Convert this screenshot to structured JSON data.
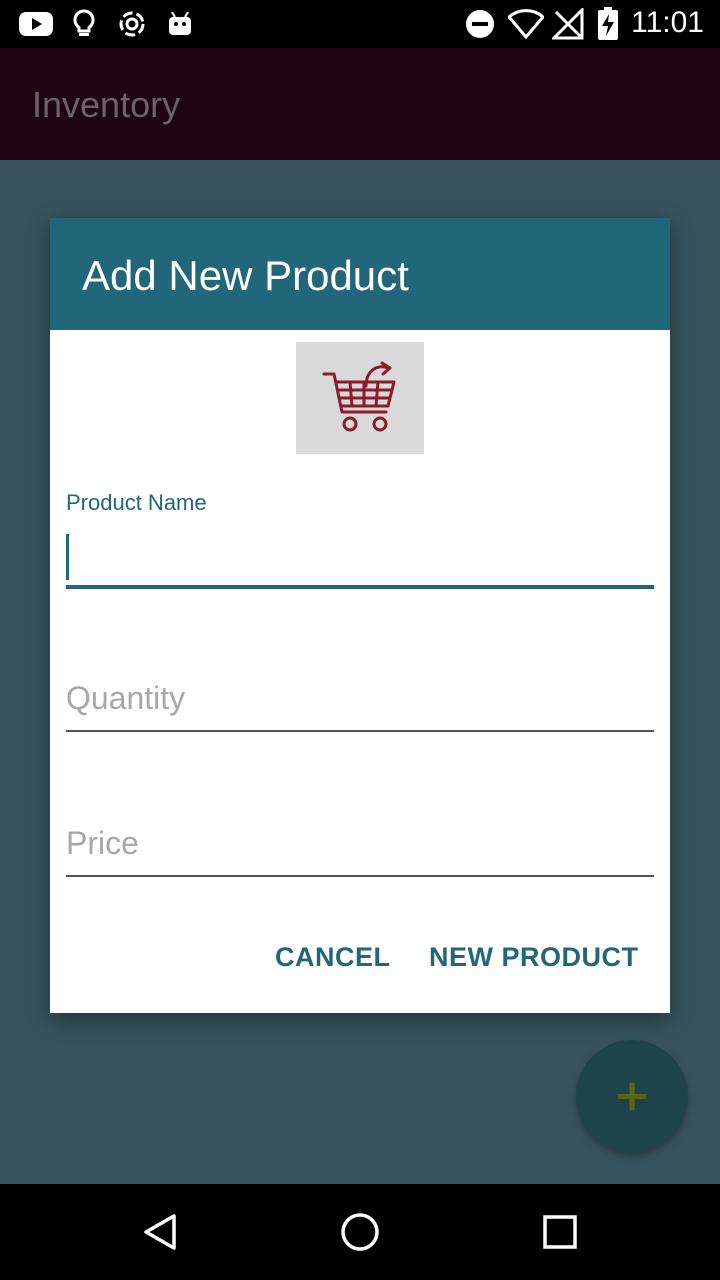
{
  "status_bar": {
    "time": "11:01",
    "left_icons": [
      "youtube-icon",
      "lightbulb-icon",
      "sync-icon",
      "android-icon"
    ],
    "right_icons": [
      "do-not-disturb-icon",
      "wifi-icon",
      "no-signal-icon",
      "battery-charging-icon"
    ]
  },
  "app_bar": {
    "title": "Inventory"
  },
  "dialog": {
    "title": "Add New Product",
    "image_icon": "shopping-cart-icon",
    "fields": {
      "product_name": {
        "label": "Product Name",
        "value": "",
        "placeholder": ""
      },
      "quantity": {
        "label": "",
        "value": "",
        "placeholder": "Quantity"
      },
      "price": {
        "label": "",
        "value": "",
        "placeholder": "Price"
      }
    },
    "buttons": {
      "cancel": "CANCEL",
      "confirm": "NEW PRODUCT"
    }
  },
  "fab": {
    "icon": "plus-icon",
    "label": "+"
  },
  "nav_bar": {
    "icons": [
      "back-icon",
      "home-icon",
      "recents-icon"
    ]
  },
  "colors": {
    "accent": "#22667a",
    "app_bar": "#1f0510",
    "scrim_background": "#37535d",
    "cart_red": "#8b1c2c"
  }
}
